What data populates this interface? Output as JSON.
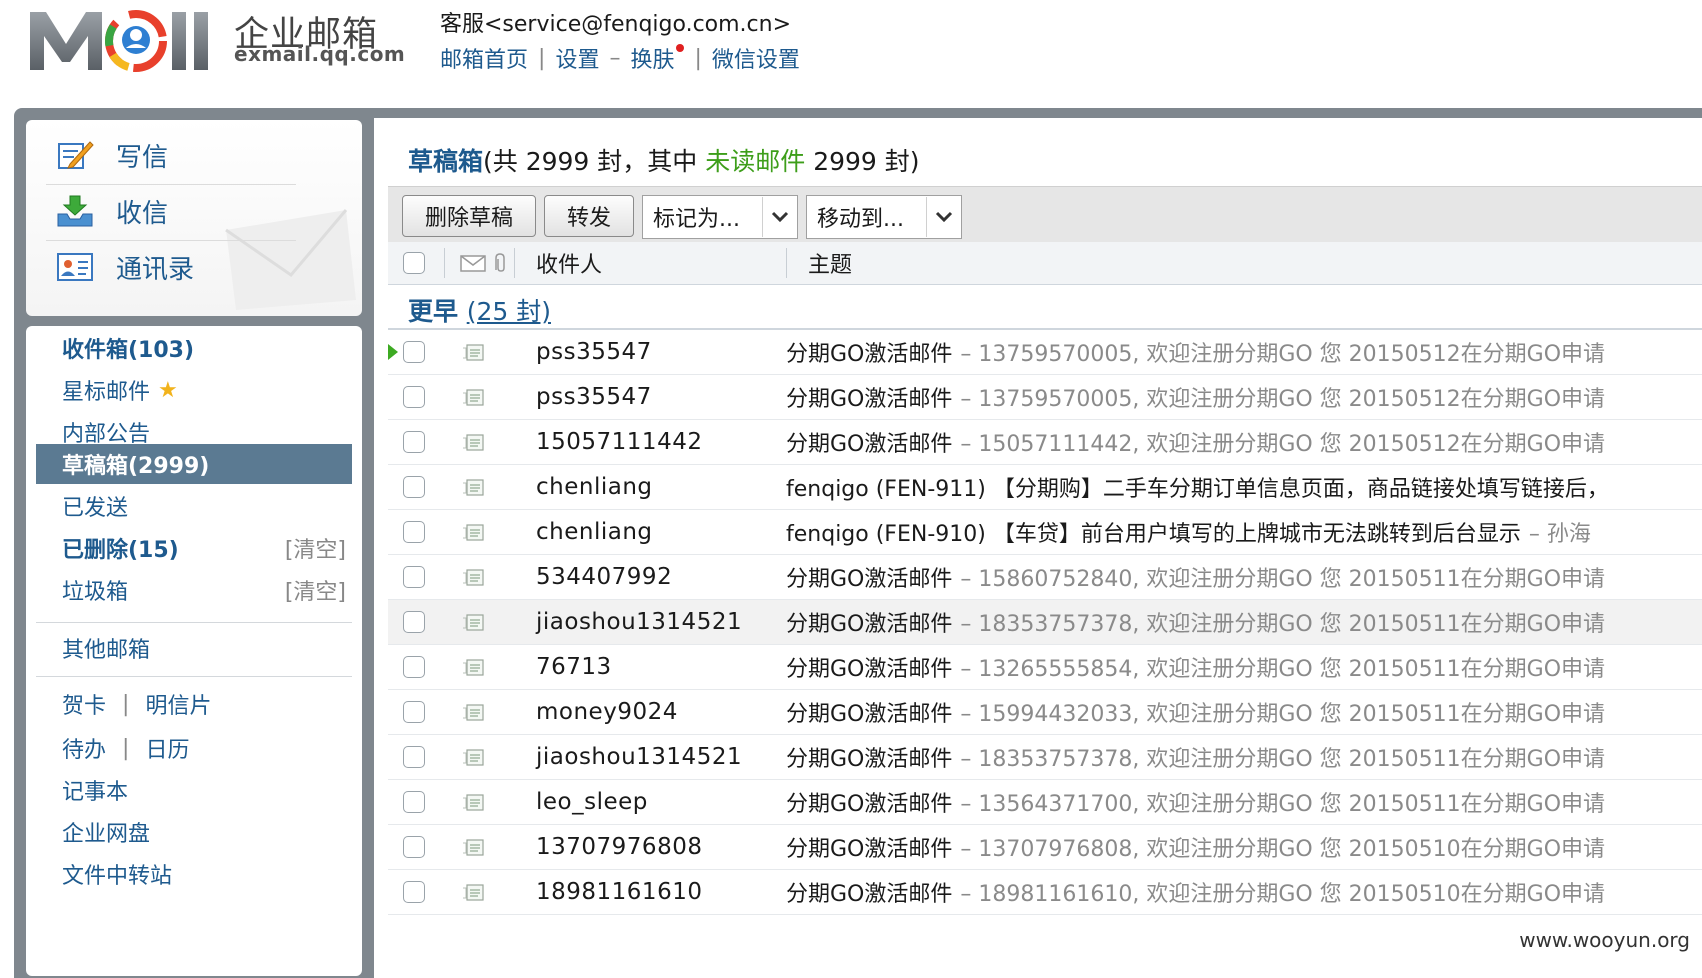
{
  "header": {
    "logo_text": "Mail",
    "brand_cn": "企业邮箱",
    "brand_domain": "exmail.qq.com",
    "service": "客服<service@fenqigo.com.cn>",
    "links": {
      "home": "邮箱首页",
      "settings": "设置",
      "dash": "–",
      "skin": "换肤",
      "wechat": "微信设置"
    },
    "sep": "|"
  },
  "quick": {
    "compose": "写信",
    "receive": "收信",
    "contacts": "通讯录"
  },
  "folders": {
    "inbox": "收件箱(103)",
    "starred": "星标邮件",
    "notice": "内部公告",
    "drafts": "草稿箱(2999)",
    "sent": "已发送",
    "deleted": "已删除(15)",
    "trash": "垃圾箱",
    "clear": "[清空]",
    "other": "其他邮箱",
    "card": "贺卡",
    "postcard": "明信片",
    "todo": "待办",
    "calendar": "日历",
    "notes": "记事本",
    "disk": "企业网盘",
    "transfer": "文件中转站",
    "pipe": "|"
  },
  "main": {
    "folder_name": "草稿箱",
    "title_mid": "(共 2999 封，其中 ",
    "unread_link": "未读邮件",
    "title_end": " 2999 封)"
  },
  "toolbar": {
    "delete": "删除草稿",
    "forward": "转发",
    "mark": "标记为...",
    "move": "移动到..."
  },
  "columns": {
    "recipient": "收件人",
    "subject": "主题"
  },
  "group": {
    "name": "更早 ",
    "count": "(25 封)"
  },
  "rows": [
    {
      "sender": "pss35547",
      "subject": "分期GO激活邮件",
      "preview": "– 13759570005, 欢迎注册分期GO 您 20150512在分期GO申请"
    },
    {
      "sender": "pss35547",
      "subject": "分期GO激活邮件",
      "preview": "– 13759570005, 欢迎注册分期GO 您 20150512在分期GO申请"
    },
    {
      "sender": "15057111442",
      "subject": "分期GO激活邮件",
      "preview": "– 15057111442, 欢迎注册分期GO 您 20150512在分期GO申请"
    },
    {
      "sender": "chenliang",
      "subject": "fenqigo (FEN-911) 【分期购】二手车分期订单信息页面，商品链接处填写链接后，",
      "preview": ""
    },
    {
      "sender": "chenliang",
      "subject": "fenqigo (FEN-910) 【车贷】前台用户填写的上牌城市无法跳转到后台显示",
      "preview": "– 孙海"
    },
    {
      "sender": "534407992",
      "subject": "分期GO激活邮件",
      "preview": "– 15860752840, 欢迎注册分期GO 您 20150511在分期GO申请"
    },
    {
      "sender": "jiaoshou1314521",
      "subject": "分期GO激活邮件",
      "preview": "– 18353757378, 欢迎注册分期GO 您 20150511在分期GO申请"
    },
    {
      "sender": "76713",
      "subject": "分期GO激活邮件",
      "preview": "– 13265555854, 欢迎注册分期GO 您 20150511在分期GO申请"
    },
    {
      "sender": "money9024",
      "subject": "分期GO激活邮件",
      "preview": "– 15994432033, 欢迎注册分期GO 您 20150511在分期GO申请"
    },
    {
      "sender": "jiaoshou1314521",
      "subject": "分期GO激活邮件",
      "preview": "– 18353757378, 欢迎注册分期GO 您 20150511在分期GO申请"
    },
    {
      "sender": "leo_sleep",
      "subject": "分期GO激活邮件",
      "preview": "– 13564371700, 欢迎注册分期GO 您 20150511在分期GO申请"
    },
    {
      "sender": "13707976808",
      "subject": "分期GO激活邮件",
      "preview": "– 13707976808, 欢迎注册分期GO 您 20150510在分期GO申请"
    },
    {
      "sender": "18981161610",
      "subject": "分期GO激活邮件",
      "preview": "– 18981161610, 欢迎注册分期GO 您 20150510在分期GO申请"
    }
  ],
  "watermark": "www.wooyun.org",
  "colors": {
    "link": "#1e5a8e",
    "unread": "#3d9e1a",
    "active_folder": "#5b7a92",
    "frame": "#7f878e"
  }
}
